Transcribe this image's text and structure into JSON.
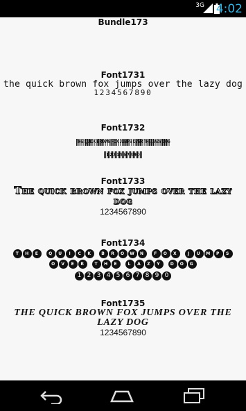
{
  "status_bar": {
    "network": "3G",
    "time": "4:02",
    "clock_color": "#33b5e5"
  },
  "bundle_title": "Bundle173",
  "fonts": [
    {
      "name": "Font1731",
      "sample_lines": [
        "the quick brown fox jumps over the lazy dog"
      ],
      "digits": "1234567890"
    },
    {
      "name": "Font1732",
      "sample_lines": [
        "THE QUICK BROWN FOX JUMPS OVER THE LAZY DOG"
      ],
      "digits": "1234567890"
    },
    {
      "name": "Font1733",
      "sample_lines": [
        "The quick brown fox jumps over the lazy",
        "dog"
      ],
      "digits": "1234567890"
    },
    {
      "name": "Font1734",
      "sample_lines": [
        "the quick brown fox jumps",
        "over the lazy dog",
        "1234567890"
      ],
      "digits": ""
    },
    {
      "name": "Font1735",
      "sample_lines": [
        "THE QUICK BROWN FOX JUMPS OVER THE",
        "LAZY DOG"
      ],
      "digits": "1234567890"
    }
  ],
  "nav_bar": {
    "back_icon": "back-arrow-icon",
    "home_icon": "home-icon",
    "recents_icon": "recents-icon"
  }
}
